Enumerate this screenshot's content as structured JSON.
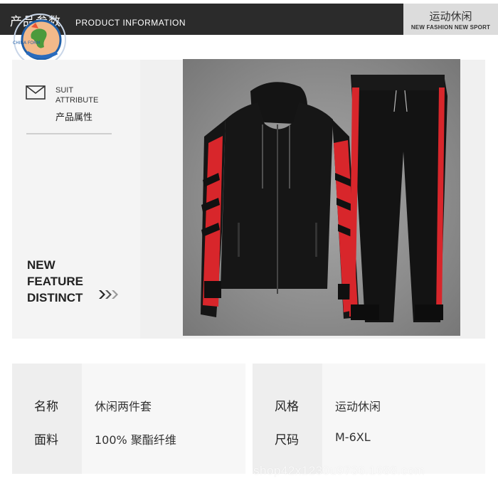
{
  "header": {
    "title_cn": "产品参数",
    "title_en": "PRODUCT INFORMATION",
    "right_cn": "运动休闲",
    "right_en": "NEW FASHION  NEW SPORT"
  },
  "logo": {
    "text": "CHINA FORM",
    "icon": "globe-logo"
  },
  "sidebar": {
    "icon": "envelope-icon",
    "suit": "SUIT",
    "attribute": "ATTRIBUTE",
    "attribute_cn": "产品属性",
    "feature_lines": [
      "NEW",
      "FEATURE",
      "DISTINCT"
    ],
    "arrow_icon": "double-chevron-right-icon"
  },
  "photo": {
    "subject": "tracksuit-image",
    "colors": {
      "body": "#151515",
      "stripe": "#d8262b"
    }
  },
  "specs": {
    "left": [
      {
        "label": "名称",
        "value": "休闲两件套"
      },
      {
        "label": "面料",
        "value": "100% 聚酯纤维"
      }
    ],
    "right": [
      {
        "label": "风格",
        "value": "运动休闲"
      },
      {
        "label": "尺码",
        "value": "M-6XL"
      }
    ]
  },
  "watermark": "shop42x1230u9736.1688.com"
}
